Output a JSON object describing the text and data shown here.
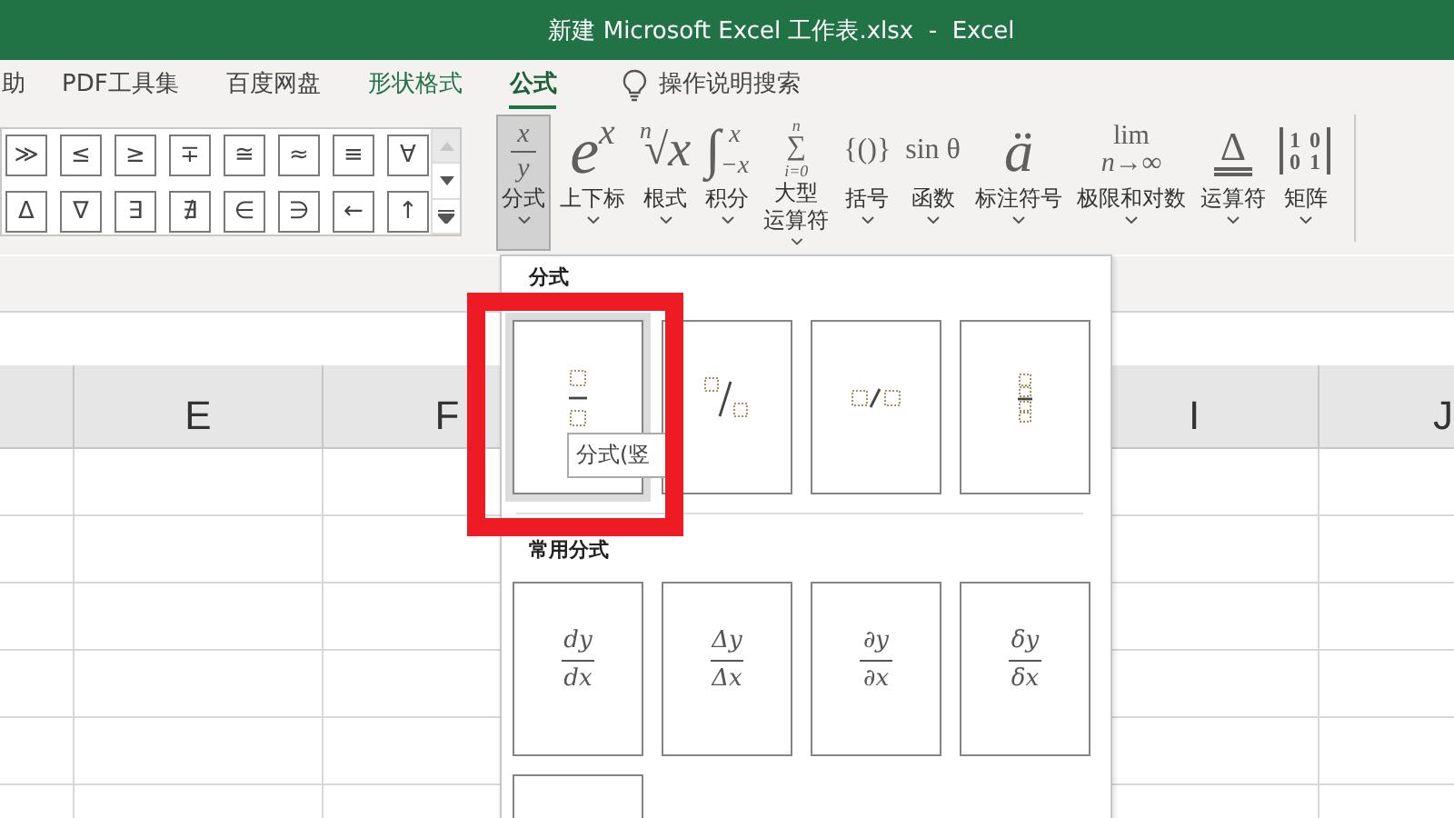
{
  "window": {
    "title": "新建 Microsoft Excel 工作表.xlsx  -  Excel"
  },
  "tabs": [
    {
      "label": "助",
      "selected": false,
      "kind": "normal"
    },
    {
      "label": "PDF工具集",
      "selected": false,
      "kind": "normal"
    },
    {
      "label": "百度网盘",
      "selected": false,
      "kind": "normal"
    },
    {
      "label": "形状格式",
      "selected": false,
      "kind": "contextual"
    },
    {
      "label": "公式",
      "selected": true,
      "kind": "normal"
    }
  ],
  "search": {
    "placeholder": "操作说明搜索"
  },
  "symbols": [
    "≫",
    "≤",
    "≥",
    "∓",
    "≅",
    "≈",
    "≡",
    "∀",
    "Δ",
    "∇",
    "∃",
    "∄",
    "∈",
    "∋",
    "←",
    "↑"
  ],
  "ribbon_buttons": [
    {
      "labels": [
        "分式"
      ],
      "selected": true,
      "glyph": {
        "kind": "fraction",
        "num": "x",
        "den": "y"
      }
    },
    {
      "labels": [
        "上下标"
      ],
      "selected": false,
      "glyph": {
        "kind": "script",
        "base": "e",
        "sup": "x"
      }
    },
    {
      "labels": [
        "根式"
      ],
      "selected": false,
      "glyph": {
        "kind": "radical",
        "index": "n",
        "sign": "√",
        "base": "x"
      }
    },
    {
      "labels": [
        "积分"
      ],
      "selected": false,
      "glyph": {
        "kind": "integral",
        "sign": "∫",
        "sup": "x",
        "sub": "−x"
      }
    },
    {
      "labels": [
        "大型",
        "运算符"
      ],
      "selected": false,
      "glyph": {
        "kind": "largeop",
        "sign": "∑",
        "sup": "n",
        "sub": "i=0"
      }
    },
    {
      "labels": [
        "括号"
      ],
      "selected": false,
      "glyph": {
        "kind": "plain",
        "text": "{()}"
      }
    },
    {
      "labels": [
        "函数"
      ],
      "selected": false,
      "glyph": {
        "kind": "plain",
        "text": "sin θ"
      }
    },
    {
      "labels": [
        "标注符号"
      ],
      "selected": false,
      "glyph": {
        "kind": "accent",
        "text": "ä"
      }
    },
    {
      "labels": [
        "极限和对数"
      ],
      "selected": false,
      "glyph": {
        "kind": "limit",
        "top": "lim",
        "bottom": "n→∞"
      }
    },
    {
      "labels": [
        "运算符"
      ],
      "selected": false,
      "glyph": {
        "kind": "operator",
        "text": "Δ"
      }
    },
    {
      "labels": [
        "矩阵"
      ],
      "selected": false,
      "glyph": {
        "kind": "matrix",
        "rows": [
          "1 0",
          "0 1"
        ]
      }
    }
  ],
  "sheet": {
    "left_columns": [
      "E",
      "F"
    ],
    "right_columns": [
      "I",
      "J"
    ]
  },
  "dropdown": {
    "section_1": {
      "title": "分式",
      "templates": [
        {
          "kind": "stacked",
          "selected": true
        },
        {
          "kind": "skewed",
          "selected": false
        },
        {
          "kind": "linear",
          "selected": false
        },
        {
          "kind": "small",
          "selected": false
        }
      ]
    },
    "tooltip": "分式(竖",
    "section_2": {
      "title": "常用分式",
      "items": [
        {
          "kind": "fraction",
          "num": "dy",
          "den": "dx"
        },
        {
          "kind": "fraction",
          "num": "Δy",
          "den": "Δx"
        },
        {
          "kind": "fraction",
          "num": "∂y",
          "den": "∂x"
        },
        {
          "kind": "fraction",
          "num": "δy",
          "den": "δx"
        },
        {
          "kind": "blank"
        }
      ]
    }
  }
}
